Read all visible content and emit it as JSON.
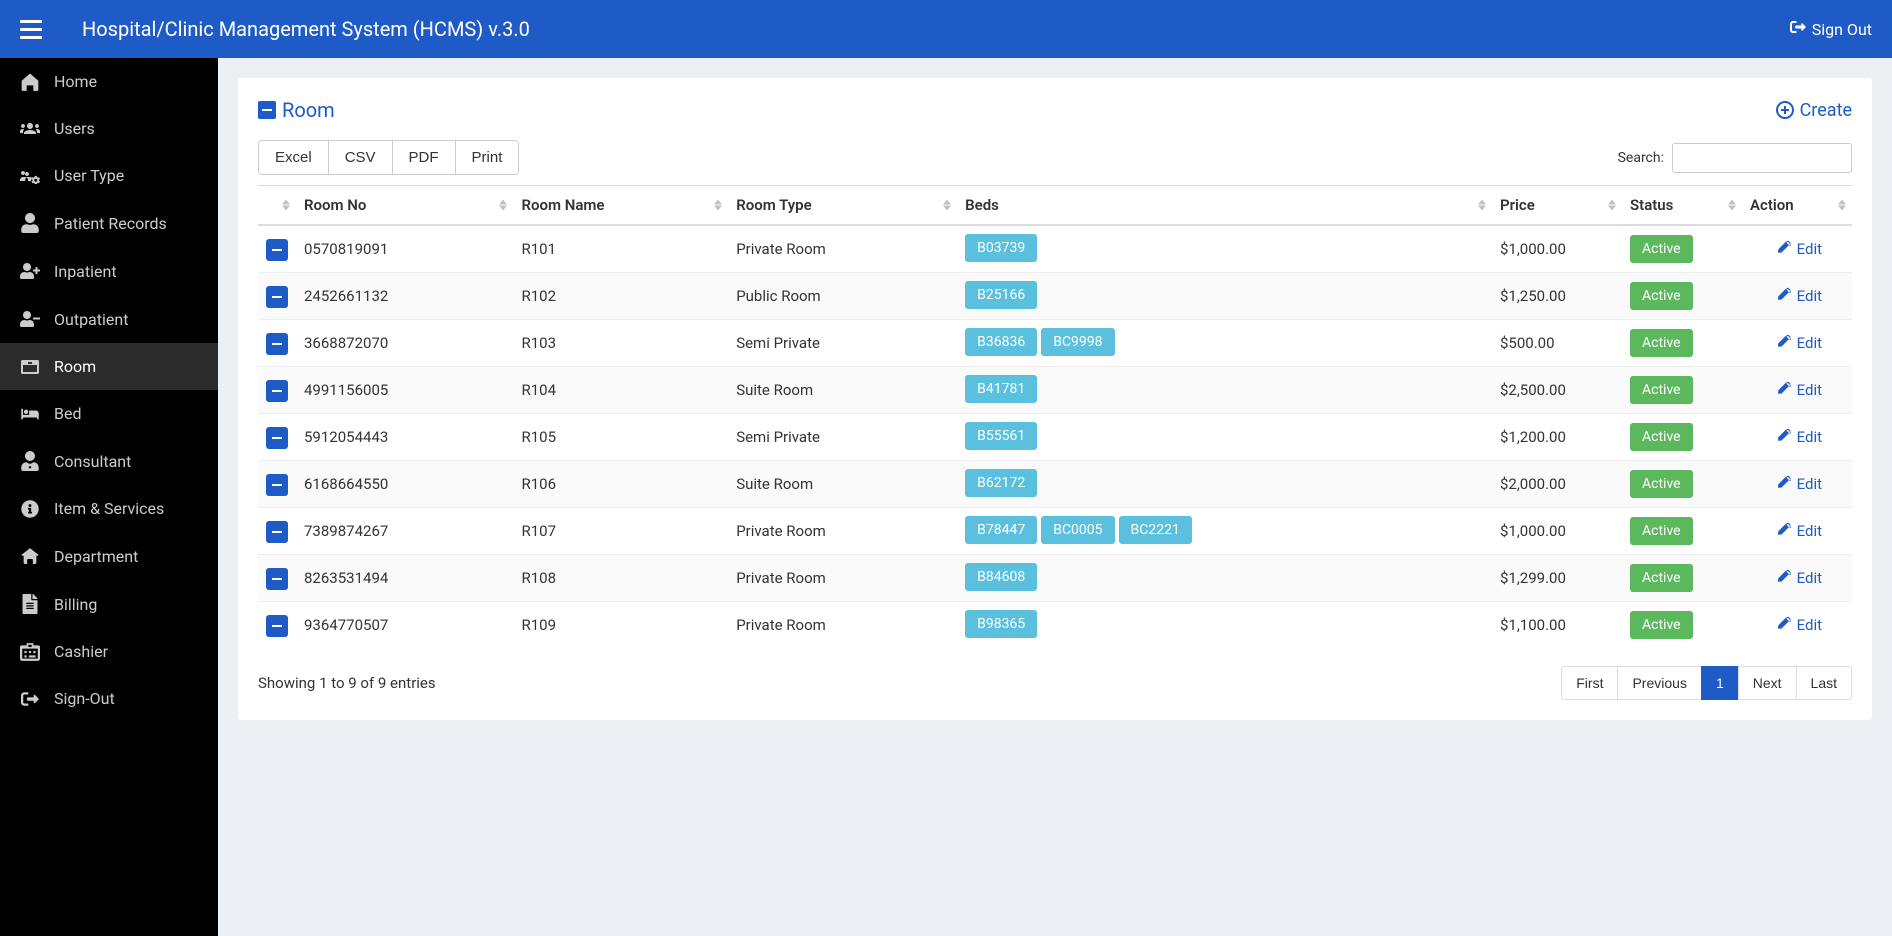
{
  "header": {
    "title": "Hospital/Clinic Management System (HCMS) v.3.0",
    "signout": "Sign Out"
  },
  "sidebar": {
    "items": [
      {
        "label": "Home",
        "icon": "home"
      },
      {
        "label": "Users",
        "icon": "users"
      },
      {
        "label": "User Type",
        "icon": "users-cog"
      },
      {
        "label": "Patient Records",
        "icon": "patient"
      },
      {
        "label": "Inpatient",
        "icon": "inpatient"
      },
      {
        "label": "Outpatient",
        "icon": "outpatient"
      },
      {
        "label": "Room",
        "icon": "room",
        "active": true
      },
      {
        "label": "Bed",
        "icon": "bed"
      },
      {
        "label": "Consultant",
        "icon": "consultant"
      },
      {
        "label": "Item & Services",
        "icon": "info"
      },
      {
        "label": "Department",
        "icon": "dept"
      },
      {
        "label": "Billing",
        "icon": "billing"
      },
      {
        "label": "Cashier",
        "icon": "cashier"
      },
      {
        "label": "Sign-Out",
        "icon": "signout"
      }
    ]
  },
  "page": {
    "title": "Room",
    "create": "Create"
  },
  "toolbar": {
    "export": [
      "Excel",
      "CSV",
      "PDF",
      "Print"
    ],
    "search_label": "Search:",
    "search_value": ""
  },
  "table": {
    "columns": [
      "",
      "Room No",
      "Room Name",
      "Room Type",
      "Beds",
      "Price",
      "Status",
      "Action"
    ],
    "rows": [
      {
        "room_no": "0570819091",
        "room_name": "R101",
        "room_type": "Private Room",
        "beds": [
          "B03739"
        ],
        "price": "$1,000.00",
        "status": "Active"
      },
      {
        "room_no": "2452661132",
        "room_name": "R102",
        "room_type": "Public Room",
        "beds": [
          "B25166"
        ],
        "price": "$1,250.00",
        "status": "Active"
      },
      {
        "room_no": "3668872070",
        "room_name": "R103",
        "room_type": "Semi Private",
        "beds": [
          "B36836",
          "BC9998"
        ],
        "price": "$500.00",
        "status": "Active"
      },
      {
        "room_no": "4991156005",
        "room_name": "R104",
        "room_type": "Suite Room",
        "beds": [
          "B41781"
        ],
        "price": "$2,500.00",
        "status": "Active"
      },
      {
        "room_no": "5912054443",
        "room_name": "R105",
        "room_type": "Semi Private",
        "beds": [
          "B55561"
        ],
        "price": "$1,200.00",
        "status": "Active"
      },
      {
        "room_no": "6168664550",
        "room_name": "R106",
        "room_type": "Suite Room",
        "beds": [
          "B62172"
        ],
        "price": "$2,000.00",
        "status": "Active"
      },
      {
        "room_no": "7389874267",
        "room_name": "R107",
        "room_type": "Private Room",
        "beds": [
          "B78447",
          "BC0005",
          "BC2221"
        ],
        "price": "$1,000.00",
        "status": "Active"
      },
      {
        "room_no": "8263531494",
        "room_name": "R108",
        "room_type": "Private Room",
        "beds": [
          "B84608"
        ],
        "price": "$1,299.00",
        "status": "Active"
      },
      {
        "room_no": "9364770507",
        "room_name": "R109",
        "room_type": "Private Room",
        "beds": [
          "B98365"
        ],
        "price": "$1,100.00",
        "status": "Active"
      }
    ],
    "edit_label": "Edit"
  },
  "footer": {
    "info": "Showing 1 to 9 of 9 entries",
    "pagination": [
      "First",
      "Previous",
      "1",
      "Next",
      "Last"
    ],
    "active_page": "1"
  }
}
